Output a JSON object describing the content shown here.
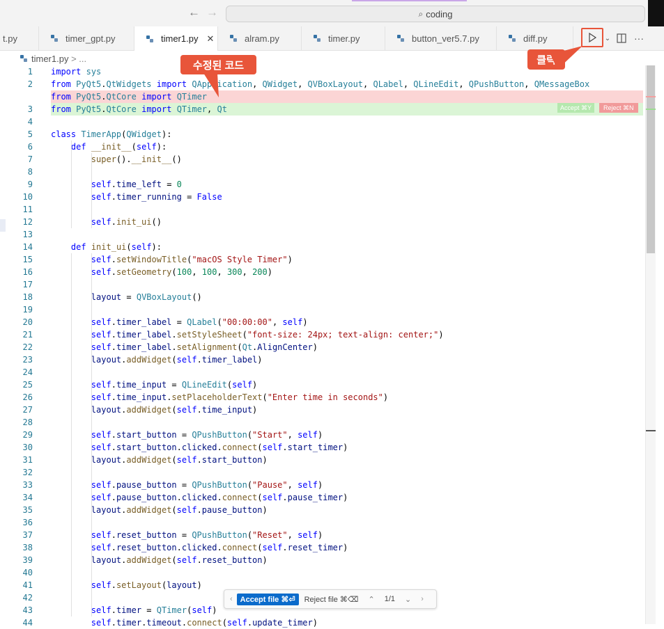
{
  "titlebar": {
    "back_icon": "arrow-left-icon",
    "forward_icon": "arrow-right-icon",
    "search_text": "coding"
  },
  "tabs": [
    {
      "label": "t.py",
      "active": false
    },
    {
      "label": "timer_gpt.py",
      "active": false
    },
    {
      "label": "timer1.py",
      "active": true
    },
    {
      "label": "alram.py",
      "active": false
    },
    {
      "label": "timer.py",
      "active": false
    },
    {
      "label": "button_ver5.7.py",
      "active": false
    },
    {
      "label": "diff.py",
      "active": false
    }
  ],
  "toolbar": {
    "run_icon": "play-icon",
    "split_icon": "split-editor-icon",
    "more_icon": "more-icon"
  },
  "breadcrumb": {
    "file": "timer1.py",
    "rest": "> ..."
  },
  "annotations": {
    "modified_code": "수정된 코드",
    "click": "클릭"
  },
  "inline_diff": {
    "accept": "Accept ⌘Y",
    "reject": "Reject ⌘N"
  },
  "diff_bar": {
    "accept": "Accept file ⌘⏎",
    "reject": "Reject file ⌘⌫",
    "counter": "1/1"
  },
  "code_lines": [
    {
      "n": "1",
      "text": "import sys",
      "type": "normal"
    },
    {
      "n": "2",
      "text": "from PyQt5.QtWidgets import QApplication, QWidget, QVBoxLayout, QLabel, QLineEdit, QPushButton, QMessageBox",
      "type": "normal"
    },
    {
      "n": "",
      "text": "from PyQt5.QtCore import QTimer",
      "type": "del"
    },
    {
      "n": "3",
      "text": "from PyQt5.QtCore import QTimer, Qt",
      "type": "add"
    },
    {
      "n": "4",
      "text": "",
      "type": "normal"
    },
    {
      "n": "5",
      "text": "class TimerApp(QWidget):",
      "type": "normal"
    },
    {
      "n": "6",
      "text": "    def __init__(self):",
      "type": "normal"
    },
    {
      "n": "7",
      "text": "        super().__init__()",
      "type": "normal"
    },
    {
      "n": "8",
      "text": "",
      "type": "normal"
    },
    {
      "n": "9",
      "text": "        self.time_left = 0",
      "type": "normal"
    },
    {
      "n": "10",
      "text": "        self.timer_running = False",
      "type": "normal"
    },
    {
      "n": "11",
      "text": "",
      "type": "normal"
    },
    {
      "n": "12",
      "text": "        self.init_ui()",
      "type": "normal"
    },
    {
      "n": "13",
      "text": "",
      "type": "normal"
    },
    {
      "n": "14",
      "text": "    def init_ui(self):",
      "type": "normal"
    },
    {
      "n": "15",
      "text": "        self.setWindowTitle(\"macOS Style Timer\")",
      "type": "normal"
    },
    {
      "n": "16",
      "text": "        self.setGeometry(100, 100, 300, 200)",
      "type": "normal"
    },
    {
      "n": "17",
      "text": "",
      "type": "normal"
    },
    {
      "n": "18",
      "text": "        layout = QVBoxLayout()",
      "type": "normal"
    },
    {
      "n": "19",
      "text": "",
      "type": "normal"
    },
    {
      "n": "20",
      "text": "        self.timer_label = QLabel(\"00:00:00\", self)",
      "type": "normal"
    },
    {
      "n": "21",
      "text": "        self.timer_label.setStyleSheet(\"font-size: 24px; text-align: center;\")",
      "type": "normal"
    },
    {
      "n": "22",
      "text": "        self.timer_label.setAlignment(Qt.AlignCenter)",
      "type": "normal"
    },
    {
      "n": "23",
      "text": "        layout.addWidget(self.timer_label)",
      "type": "normal"
    },
    {
      "n": "24",
      "text": "",
      "type": "normal"
    },
    {
      "n": "25",
      "text": "        self.time_input = QLineEdit(self)",
      "type": "normal"
    },
    {
      "n": "26",
      "text": "        self.time_input.setPlaceholderText(\"Enter time in seconds\")",
      "type": "normal"
    },
    {
      "n": "27",
      "text": "        layout.addWidget(self.time_input)",
      "type": "normal"
    },
    {
      "n": "28",
      "text": "",
      "type": "normal"
    },
    {
      "n": "29",
      "text": "        self.start_button = QPushButton(\"Start\", self)",
      "type": "normal"
    },
    {
      "n": "30",
      "text": "        self.start_button.clicked.connect(self.start_timer)",
      "type": "normal"
    },
    {
      "n": "31",
      "text": "        layout.addWidget(self.start_button)",
      "type": "normal"
    },
    {
      "n": "32",
      "text": "",
      "type": "normal"
    },
    {
      "n": "33",
      "text": "        self.pause_button = QPushButton(\"Pause\", self)",
      "type": "normal"
    },
    {
      "n": "34",
      "text": "        self.pause_button.clicked.connect(self.pause_timer)",
      "type": "normal"
    },
    {
      "n": "35",
      "text": "        layout.addWidget(self.pause_button)",
      "type": "normal"
    },
    {
      "n": "36",
      "text": "",
      "type": "normal"
    },
    {
      "n": "37",
      "text": "        self.reset_button = QPushButton(\"Reset\", self)",
      "type": "normal"
    },
    {
      "n": "38",
      "text": "        self.reset_button.clicked.connect(self.reset_timer)",
      "type": "normal"
    },
    {
      "n": "39",
      "text": "        layout.addWidget(self.reset_button)",
      "type": "normal"
    },
    {
      "n": "40",
      "text": "",
      "type": "normal"
    },
    {
      "n": "41",
      "text": "        self.setLayout(layout)",
      "type": "normal"
    },
    {
      "n": "42",
      "text": "",
      "type": "normal"
    },
    {
      "n": "43",
      "text": "        self.timer = QTimer(self)",
      "type": "normal"
    },
    {
      "n": "44",
      "text": "        self.timer.timeout.connect(self.update_timer)",
      "type": "normal"
    }
  ],
  "colors": {
    "callout": "#e8553a",
    "deleted_line": "#fbd5d5",
    "added_line": "#dbf5d6",
    "accept_button": "#0b6bcb"
  }
}
